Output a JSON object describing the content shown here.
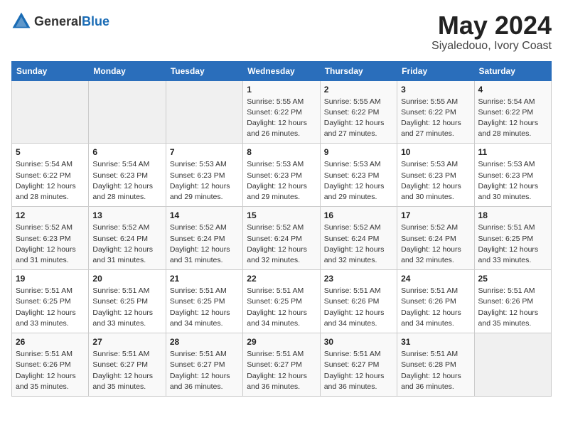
{
  "header": {
    "logo": {
      "general": "General",
      "blue": "Blue"
    },
    "month": "May 2024",
    "location": "Siyaledouo, Ivory Coast"
  },
  "weekdays": [
    "Sunday",
    "Monday",
    "Tuesday",
    "Wednesday",
    "Thursday",
    "Friday",
    "Saturday"
  ],
  "weeks": [
    [
      {
        "day": "",
        "info": ""
      },
      {
        "day": "",
        "info": ""
      },
      {
        "day": "",
        "info": ""
      },
      {
        "day": "1",
        "info": "Sunrise: 5:55 AM\nSunset: 6:22 PM\nDaylight: 12 hours and 26 minutes."
      },
      {
        "day": "2",
        "info": "Sunrise: 5:55 AM\nSunset: 6:22 PM\nDaylight: 12 hours and 27 minutes."
      },
      {
        "day": "3",
        "info": "Sunrise: 5:55 AM\nSunset: 6:22 PM\nDaylight: 12 hours and 27 minutes."
      },
      {
        "day": "4",
        "info": "Sunrise: 5:54 AM\nSunset: 6:22 PM\nDaylight: 12 hours and 28 minutes."
      }
    ],
    [
      {
        "day": "5",
        "info": "Sunrise: 5:54 AM\nSunset: 6:22 PM\nDaylight: 12 hours and 28 minutes."
      },
      {
        "day": "6",
        "info": "Sunrise: 5:54 AM\nSunset: 6:23 PM\nDaylight: 12 hours and 28 minutes."
      },
      {
        "day": "7",
        "info": "Sunrise: 5:53 AM\nSunset: 6:23 PM\nDaylight: 12 hours and 29 minutes."
      },
      {
        "day": "8",
        "info": "Sunrise: 5:53 AM\nSunset: 6:23 PM\nDaylight: 12 hours and 29 minutes."
      },
      {
        "day": "9",
        "info": "Sunrise: 5:53 AM\nSunset: 6:23 PM\nDaylight: 12 hours and 29 minutes."
      },
      {
        "day": "10",
        "info": "Sunrise: 5:53 AM\nSunset: 6:23 PM\nDaylight: 12 hours and 30 minutes."
      },
      {
        "day": "11",
        "info": "Sunrise: 5:53 AM\nSunset: 6:23 PM\nDaylight: 12 hours and 30 minutes."
      }
    ],
    [
      {
        "day": "12",
        "info": "Sunrise: 5:52 AM\nSunset: 6:23 PM\nDaylight: 12 hours and 31 minutes."
      },
      {
        "day": "13",
        "info": "Sunrise: 5:52 AM\nSunset: 6:24 PM\nDaylight: 12 hours and 31 minutes."
      },
      {
        "day": "14",
        "info": "Sunrise: 5:52 AM\nSunset: 6:24 PM\nDaylight: 12 hours and 31 minutes."
      },
      {
        "day": "15",
        "info": "Sunrise: 5:52 AM\nSunset: 6:24 PM\nDaylight: 12 hours and 32 minutes."
      },
      {
        "day": "16",
        "info": "Sunrise: 5:52 AM\nSunset: 6:24 PM\nDaylight: 12 hours and 32 minutes."
      },
      {
        "day": "17",
        "info": "Sunrise: 5:52 AM\nSunset: 6:24 PM\nDaylight: 12 hours and 32 minutes."
      },
      {
        "day": "18",
        "info": "Sunrise: 5:51 AM\nSunset: 6:25 PM\nDaylight: 12 hours and 33 minutes."
      }
    ],
    [
      {
        "day": "19",
        "info": "Sunrise: 5:51 AM\nSunset: 6:25 PM\nDaylight: 12 hours and 33 minutes."
      },
      {
        "day": "20",
        "info": "Sunrise: 5:51 AM\nSunset: 6:25 PM\nDaylight: 12 hours and 33 minutes."
      },
      {
        "day": "21",
        "info": "Sunrise: 5:51 AM\nSunset: 6:25 PM\nDaylight: 12 hours and 34 minutes."
      },
      {
        "day": "22",
        "info": "Sunrise: 5:51 AM\nSunset: 6:25 PM\nDaylight: 12 hours and 34 minutes."
      },
      {
        "day": "23",
        "info": "Sunrise: 5:51 AM\nSunset: 6:26 PM\nDaylight: 12 hours and 34 minutes."
      },
      {
        "day": "24",
        "info": "Sunrise: 5:51 AM\nSunset: 6:26 PM\nDaylight: 12 hours and 34 minutes."
      },
      {
        "day": "25",
        "info": "Sunrise: 5:51 AM\nSunset: 6:26 PM\nDaylight: 12 hours and 35 minutes."
      }
    ],
    [
      {
        "day": "26",
        "info": "Sunrise: 5:51 AM\nSunset: 6:26 PM\nDaylight: 12 hours and 35 minutes."
      },
      {
        "day": "27",
        "info": "Sunrise: 5:51 AM\nSunset: 6:27 PM\nDaylight: 12 hours and 35 minutes."
      },
      {
        "day": "28",
        "info": "Sunrise: 5:51 AM\nSunset: 6:27 PM\nDaylight: 12 hours and 36 minutes."
      },
      {
        "day": "29",
        "info": "Sunrise: 5:51 AM\nSunset: 6:27 PM\nDaylight: 12 hours and 36 minutes."
      },
      {
        "day": "30",
        "info": "Sunrise: 5:51 AM\nSunset: 6:27 PM\nDaylight: 12 hours and 36 minutes."
      },
      {
        "day": "31",
        "info": "Sunrise: 5:51 AM\nSunset: 6:28 PM\nDaylight: 12 hours and 36 minutes."
      },
      {
        "day": "",
        "info": ""
      }
    ]
  ]
}
